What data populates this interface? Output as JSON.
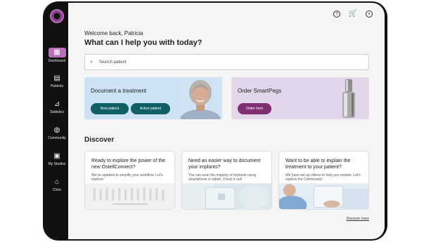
{
  "sidebar": {
    "items": [
      {
        "label": "Dashboard",
        "icon": "grid-icon",
        "glyph": "▦",
        "active": true
      },
      {
        "label": "Patients",
        "icon": "clipboard-icon",
        "glyph": "▤",
        "active": false
      },
      {
        "label": "Statistics",
        "icon": "chart-icon",
        "glyph": "⊿",
        "active": false
      },
      {
        "label": "Community",
        "icon": "globe-icon",
        "glyph": "◍",
        "active": false
      },
      {
        "label": "My Studies",
        "icon": "folder-icon",
        "glyph": "▣",
        "active": false
      },
      {
        "label": "Clinic",
        "icon": "building-icon",
        "glyph": "⌂",
        "active": false
      }
    ]
  },
  "topbar": {
    "help_glyph": "?",
    "cart_glyph": "🛒",
    "account_glyph": "•"
  },
  "greeting": {
    "welcome": "Welcome back, Patricia",
    "headline": "What can I help you with today?"
  },
  "search": {
    "placeholder": "Search patient"
  },
  "treatment_card": {
    "title": "Document a treatment",
    "new_patient": "New patient",
    "active_patient": "Active patient"
  },
  "smartpegs_card": {
    "title": "Order SmartPegs",
    "order_here": "Order here"
  },
  "discover": {
    "title": "Discover",
    "cards": [
      {
        "title": "Ready to explore the power of the new OstellConnect?",
        "body": "We've updated to simplify your workflow. Let's explore!"
      },
      {
        "title": "Need an easier way to document your implants?",
        "body": "You can scan the majority of implants using smartphone or tablet. Check it out!"
      },
      {
        "title": "Want to be able to explain the treatment to your patient?",
        "body": "We have set up videos to help you explain. Let's explore the Community!"
      }
    ],
    "more": "Discover more"
  }
}
